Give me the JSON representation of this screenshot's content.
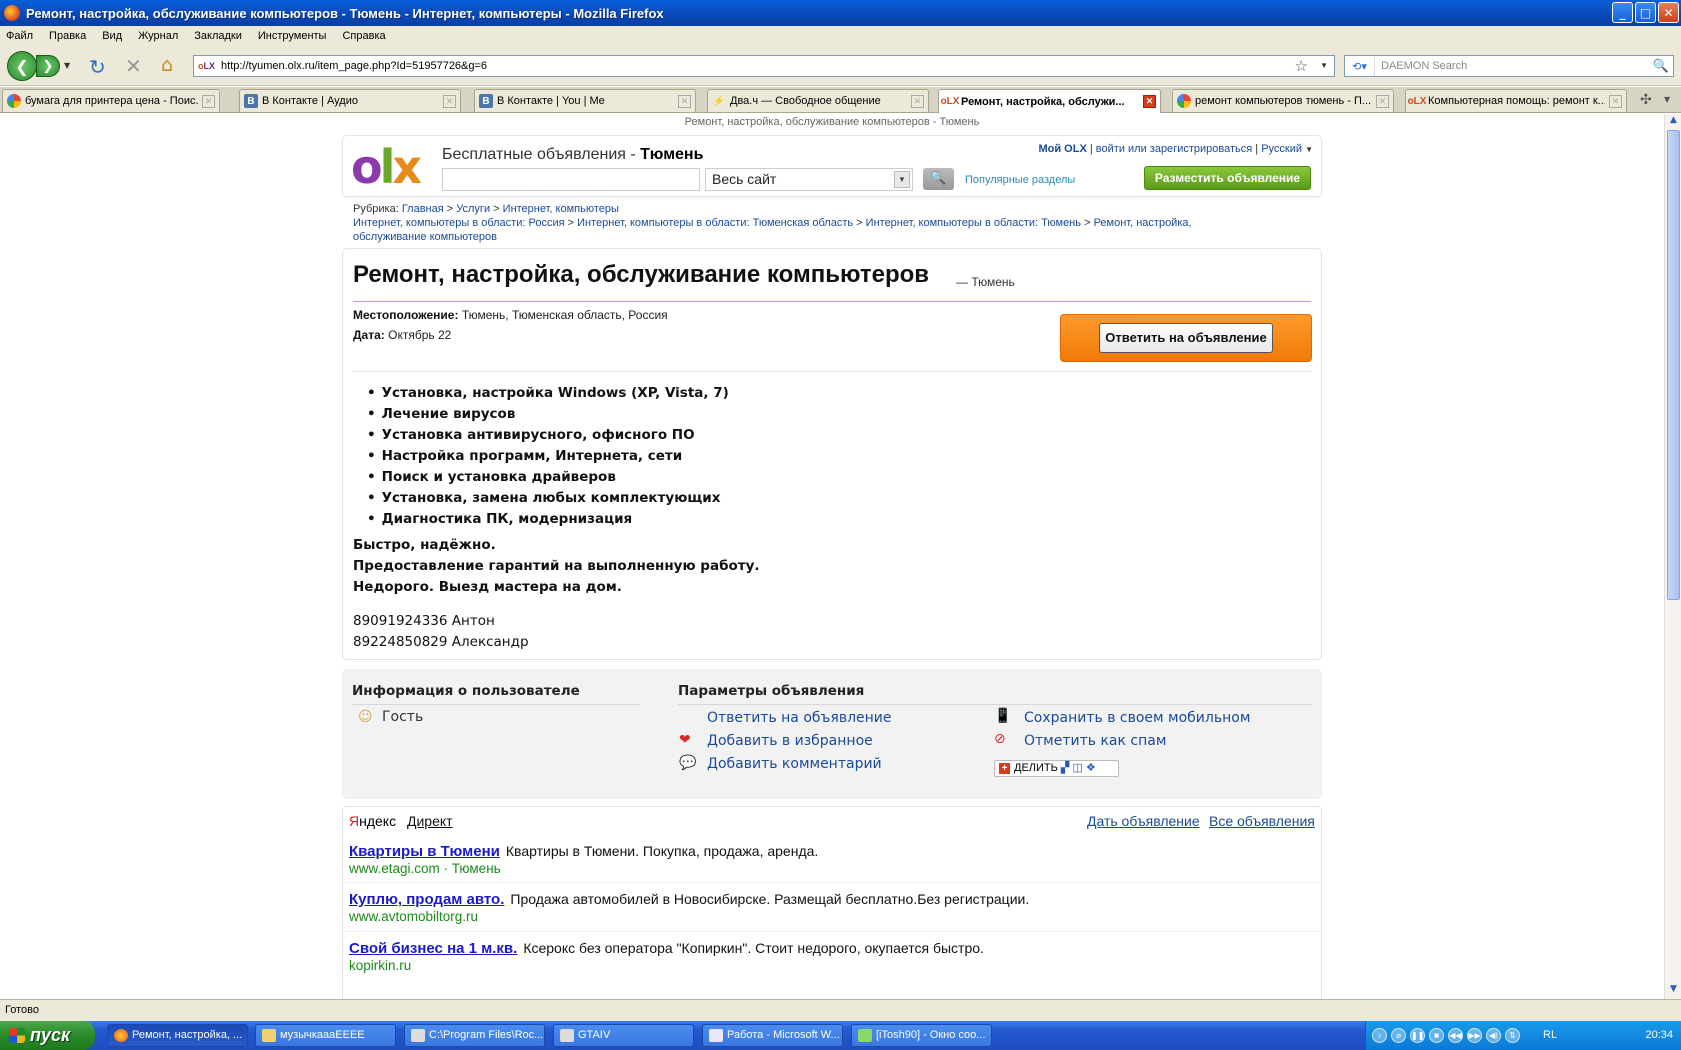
{
  "window": {
    "title": "Ремонт, настройка, обслуживание компьютеров - Тюмень - Интернет, компьютеры - Mozilla Firefox",
    "controls": {
      "minimize": "_",
      "maximize": "□",
      "close": "✕"
    }
  },
  "menu": [
    "Файл",
    "Правка",
    "Вид",
    "Журнал",
    "Закладки",
    "Инструменты",
    "Справка"
  ],
  "toolbar": {
    "url": "http://tyumen.olx.ru/item_page.php?Id=51957726&g=6",
    "search_placeholder": "DAEMON Search",
    "nav_glyphs": {
      "back": "❮",
      "forward": "❯",
      "dropdown": "▼",
      "reload": "↻",
      "stop": "✕",
      "home": "⌂",
      "star": "☆",
      "search": "🔍",
      "new_tab": "✣"
    },
    "url_favicon": {
      "o": "o",
      "lx": "LX"
    }
  },
  "tabs": [
    {
      "label": "бумага для принтера цена - Поис...",
      "favicon": "google-icon",
      "active": false
    },
    {
      "label": "В Контакте | Аудио",
      "favicon": "vk-icon",
      "active": false
    },
    {
      "label": "В Контакте | You | Me",
      "favicon": "vk-icon",
      "active": false
    },
    {
      "label": "Два.ч — Свободное общение",
      "favicon": "2ch-icon",
      "active": false
    },
    {
      "label": "Ремонт, настройка, обслужи...",
      "favicon": "olx-icon",
      "active": true
    },
    {
      "label": "ремонт компьютеров тюмень - П...",
      "favicon": "google-icon",
      "active": false
    },
    {
      "label": "Компьютерная помощь: ремонт к...",
      "favicon": "olx-icon",
      "active": false
    }
  ],
  "tab_glyphs": {
    "vk": "В",
    "twoch": "⚡",
    "olx": "oLX",
    "close": "✕"
  },
  "page": {
    "top_title": "Ремонт, настройка, обслуживание компьютеров - Тюмень",
    "header": {
      "logo": {
        "o": "o",
        "l": "l",
        "x": "x"
      },
      "tagline": "Бесплатные объявления - ",
      "city": "Тюмень",
      "search_value": "",
      "scope": "Весь сайт",
      "scope_dropdown": "▼",
      "search_glyph": "🔍",
      "popular": "Популярные разделы",
      "my_olx": "Мой OLX",
      "sep": "|",
      "login": "войти или зарегистрироваться",
      "language": "Русский",
      "language_dropdown": "▼",
      "post_button": "Разместить объявление"
    },
    "breadcrumb": {
      "prefix": "Рубрика:",
      "sep": ">",
      "items": [
        "Главная",
        "Услуги",
        "Интернет, компьютеры",
        "Интернет, компьютеры в области: Россия",
        "Интернет, компьютеры в области: Тюменская область",
        "Интернет, компьютеры в области: Тюмень"
      ],
      "current": "Ремонт, настройка, обслуживание компьютеров"
    },
    "listing": {
      "title": "Ремонт, настройка, обслуживание компьютеров",
      "title_city": "— Тюмень",
      "location_label": "Местоположение:",
      "location": "Тюмень, Тюменская область, Россия",
      "date_label": "Дата:",
      "date": "Октябрь 22",
      "reply_button": "Ответить на объявление",
      "services": [
        "Установка, настройка Windows (XP, Vista, 7)",
        "Лечение вирусов",
        "Установка антивирусного, офисного ПО",
        "Настройка программ, Интернета, сети",
        "Поиск и установка драйверов",
        "Установка, замена любых комплектующих",
        "Диагностика ПК, модернизация"
      ],
      "description": [
        "Быстро, надёжно.",
        "Предоставление гарантий на выполненную работу.",
        "Недорого. Выезд мастера на дом."
      ],
      "phones": [
        "89091924336 Антон",
        "89224850829 Александр"
      ]
    },
    "user_info": {
      "heading": "Информация о пользователе",
      "user": "Гость"
    },
    "ad_params": {
      "heading": "Параметры объявления",
      "reply": "Ответить на объявление",
      "favorite": "Добавить в избранное",
      "comment": "Добавить комментарий",
      "save_mobile": "Сохранить в своем мобильном",
      "spam": "Отметить как спам",
      "share": "ДЕЛИТЬ",
      "share_plus": "+"
    },
    "ads": {
      "brand_first": "Я",
      "brand_rest": "ндекс",
      "direct": "Директ",
      "give_ad": "Дать объявление",
      "all_ads": "Все объявления",
      "items": [
        {
          "title": "Квартиры в Тюмени",
          "text": "Квартиры в Тюмени. Покупка, продажа, аренда.",
          "url": "www.etagi.com · Тюмень"
        },
        {
          "title": "Куплю, продам авто.",
          "text": "Продажа автомобилей в Новосибирске. Размещай бесплатно.Без регистрации.",
          "url": "www.avtomobiltorg.ru"
        },
        {
          "title": "Свой бизнес на 1 м.кв.",
          "text": "Ксерокс без оператора \"Копиркин\". Стоит недорого, окупается быстро.",
          "url": "kopirkin.ru"
        }
      ]
    }
  },
  "status": "Готово",
  "scroll_glyphs": {
    "up": "▲",
    "down": "▼"
  },
  "taskbar": {
    "start": "пуск",
    "tasks": [
      {
        "label": "Ремонт, настройка, ...",
        "active": true
      },
      {
        "label": "музычкаааЕЕЕЕ",
        "active": false
      },
      {
        "label": "C:\\Program Files\\Roc...",
        "active": false
      },
      {
        "label": "GTAIV",
        "active": false
      },
      {
        "label": "Работа - Microsoft W...",
        "active": false
      },
      {
        "label": "[iTosh90] - Окно соо...",
        "active": false
      }
    ],
    "tray_glyphs": [
      "♪",
      "⌀",
      "❚❚",
      "■",
      "◀◀",
      "▶▶",
      "◀)",
      "⇅"
    ],
    "lang": "RL",
    "clock": "20:34"
  }
}
